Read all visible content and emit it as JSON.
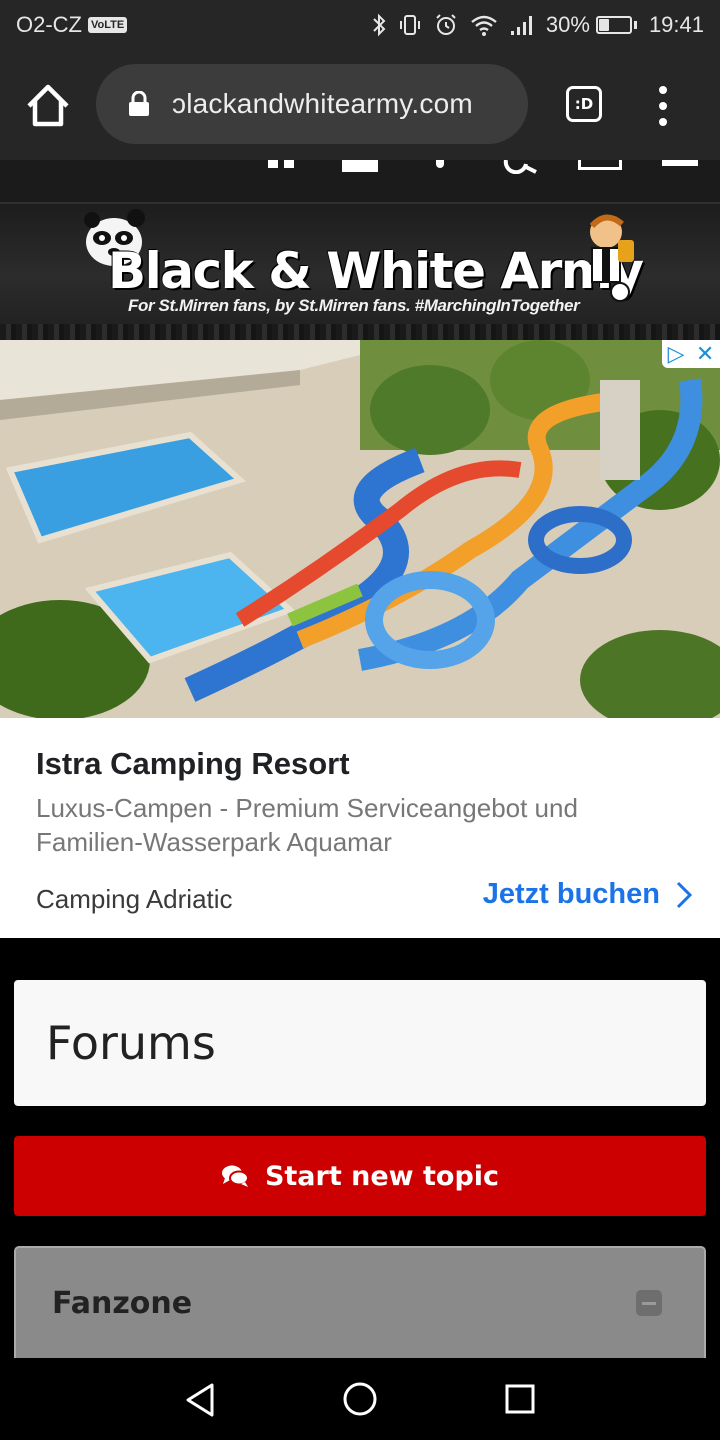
{
  "status_bar": {
    "carrier": "O2-CZ",
    "volte": "VoLTE",
    "battery_percent": "30%",
    "battery_level": 0.3,
    "time": "19:41",
    "icons": [
      "bluetooth-icon",
      "vibrate-icon",
      "alarm-icon",
      "wifi-icon",
      "signal-icon",
      "battery-icon"
    ]
  },
  "browser": {
    "url": "ɔlackandwhitearmy.com",
    "tabs_label": ":D",
    "icons": [
      "home-icon",
      "lock-icon",
      "tabs-icon",
      "menu-icon"
    ]
  },
  "banner": {
    "title": "Black & White Army",
    "tagline": "For St.Mirren fans, by St.Mirren fans. #MarchingInTogether"
  },
  "ad": {
    "title": "Istra Camping Resort",
    "description": "Luxus-Campen - Premium Serviceangebot und Familien-Wasserpark Aquamar",
    "advertiser": "Camping Adriatic",
    "cta": "Jetzt buchen"
  },
  "forums": {
    "title": "Forums",
    "start_topic": "Start new topic"
  },
  "category": {
    "title": "Fanzone"
  },
  "colors": {
    "accent_red": "#cc0000",
    "link_blue": "#1a73e8",
    "chrome_bg": "#262626"
  }
}
